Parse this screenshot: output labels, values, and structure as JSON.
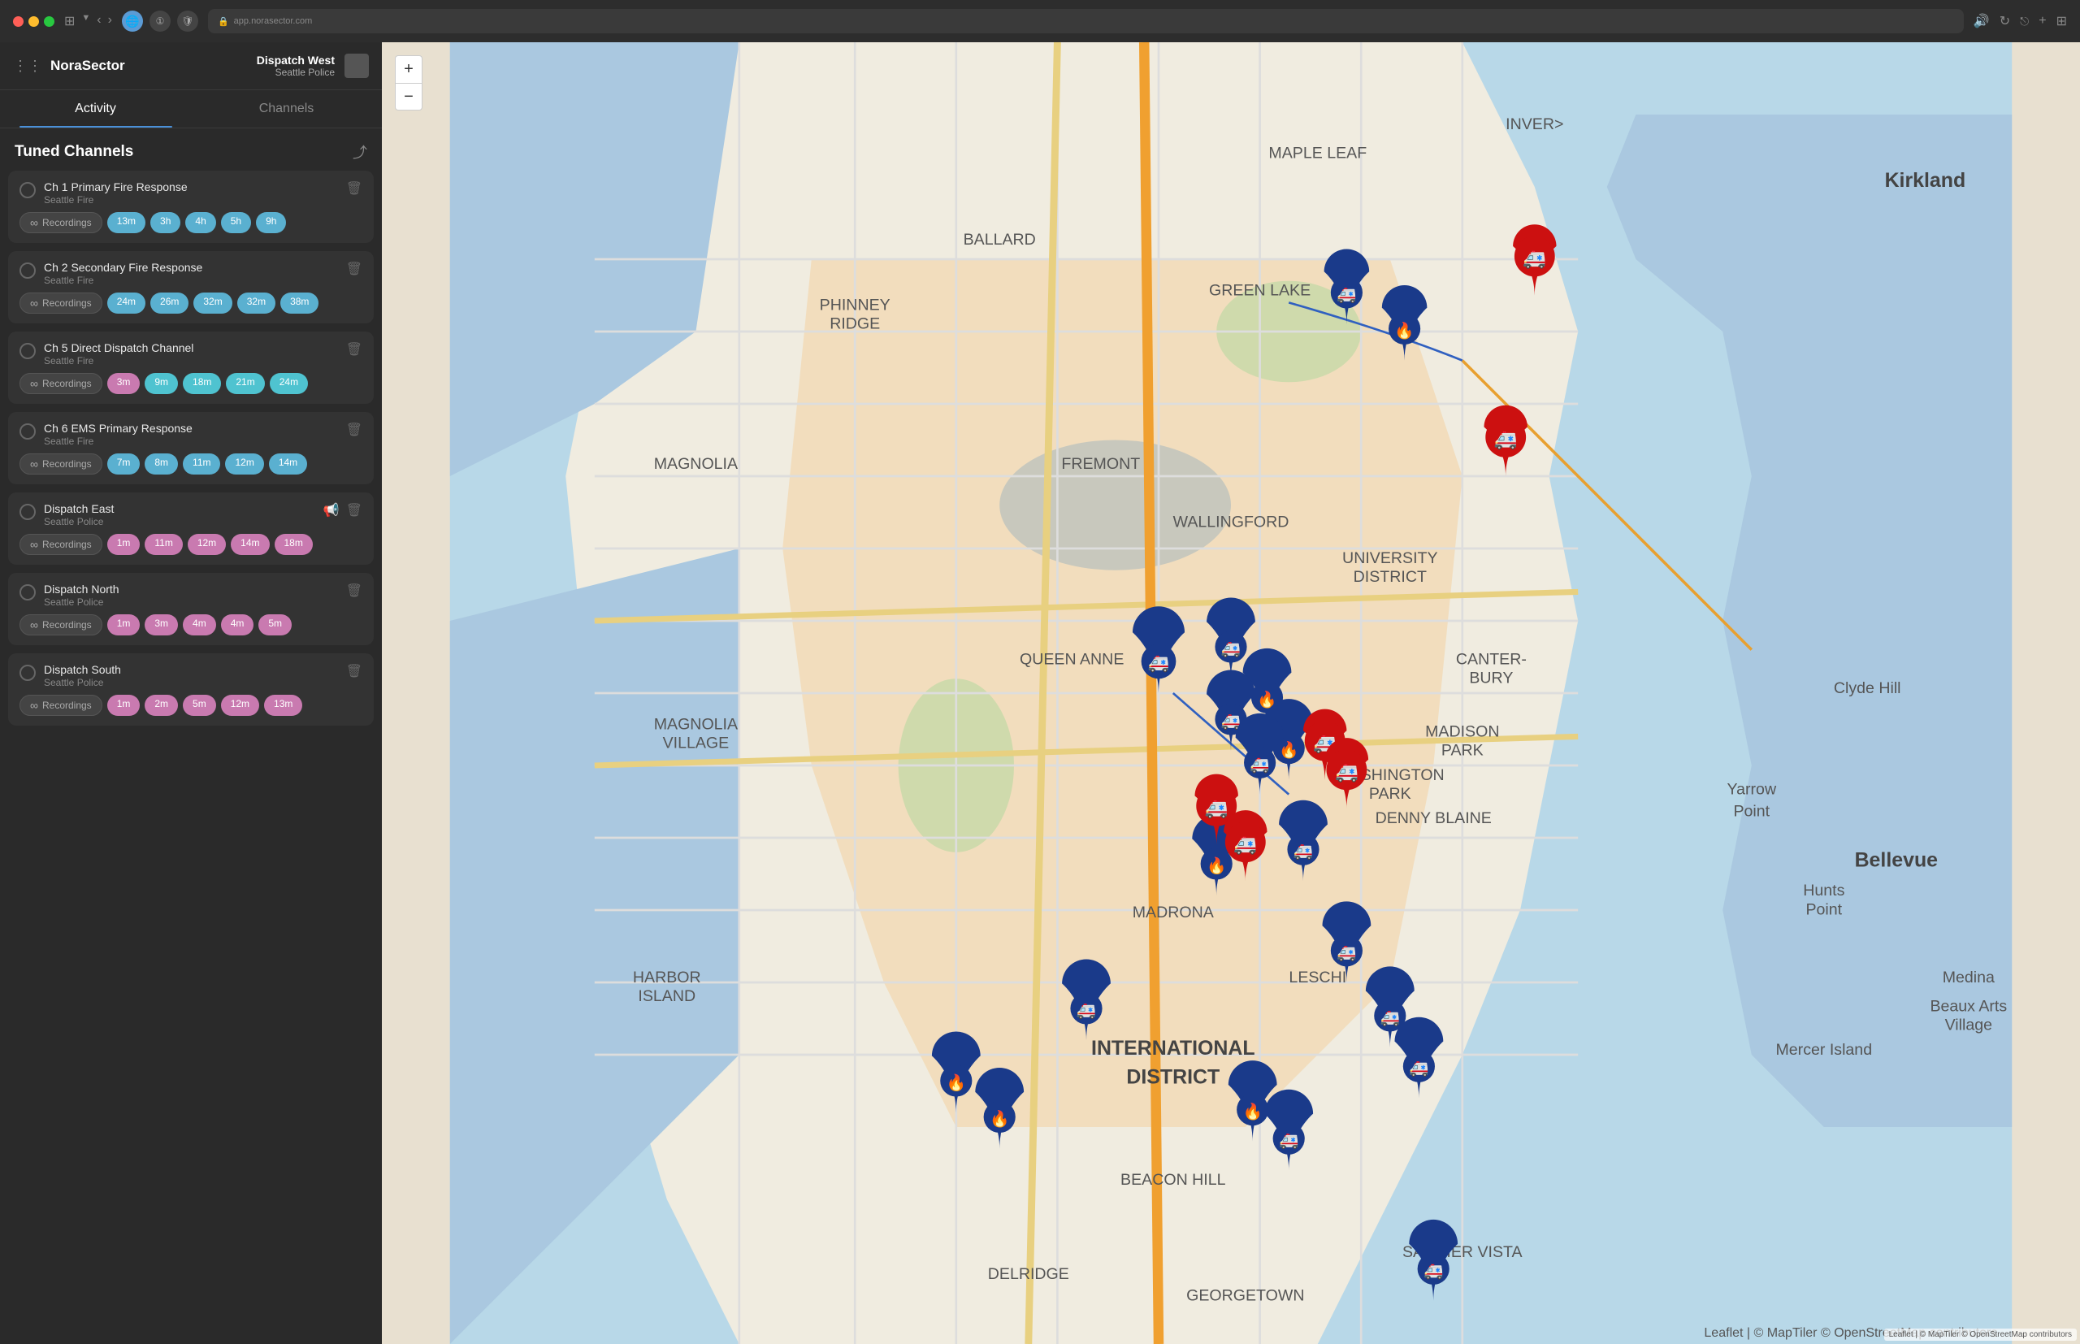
{
  "browser": {
    "url": "app.norasector.com",
    "url_prefix": "🔒"
  },
  "app": {
    "name": "NoraSector",
    "dispatch_title": "Dispatch West",
    "dispatch_subtitle": "Seattle Police"
  },
  "tabs": [
    {
      "id": "activity",
      "label": "Activity",
      "active": true
    },
    {
      "id": "channels",
      "label": "Channels",
      "active": false
    }
  ],
  "tuned_channels": {
    "title": "Tuned Channels",
    "channels": [
      {
        "id": 1,
        "name": "Ch 1 Primary Fire Response",
        "org": "Seattle Fire",
        "alert": false,
        "pill_color": "blue",
        "pills": [
          "13m",
          "3h",
          "4h",
          "5h",
          "9h"
        ]
      },
      {
        "id": 2,
        "name": "Ch 2 Secondary Fire Response",
        "org": "Seattle Fire",
        "alert": false,
        "pill_color": "blue",
        "pills": [
          "24m",
          "26m",
          "32m",
          "32m",
          "38m"
        ]
      },
      {
        "id": 3,
        "name": "Ch 5 Direct Dispatch Channel",
        "org": "Seattle Fire",
        "alert": false,
        "pill_color": "teal",
        "pills": [
          "3m",
          "9m",
          "18m",
          "21m",
          "24m"
        ],
        "first_pill_color": "pink"
      },
      {
        "id": 4,
        "name": "Ch 6 EMS Primary Response",
        "org": "Seattle Fire",
        "alert": false,
        "pill_color": "blue",
        "pills": [
          "7m",
          "8m",
          "11m",
          "12m",
          "14m"
        ]
      },
      {
        "id": 5,
        "name": "Dispatch East",
        "org": "Seattle Police",
        "alert": true,
        "pill_color": "purple",
        "pills": [
          "1m",
          "11m",
          "12m",
          "14m",
          "18m"
        ],
        "first_pill_color": "pink"
      },
      {
        "id": 6,
        "name": "Dispatch North",
        "org": "Seattle Police",
        "alert": false,
        "pill_color": "purple",
        "pills": [
          "1m",
          "3m",
          "4m",
          "4m",
          "5m"
        ],
        "first_pill_color": "pink"
      },
      {
        "id": 7,
        "name": "Dispatch South",
        "org": "Seattle Police",
        "alert": false,
        "pill_color": "purple",
        "pills": [
          "1m",
          "2m",
          "5m",
          "12m",
          "13m"
        ],
        "first_pill_color": "pink"
      }
    ]
  },
  "map": {
    "attribution": "Leaflet | © MapTiler © OpenStreetMap contributors",
    "zoom_in": "+",
    "zoom_out": "−"
  }
}
